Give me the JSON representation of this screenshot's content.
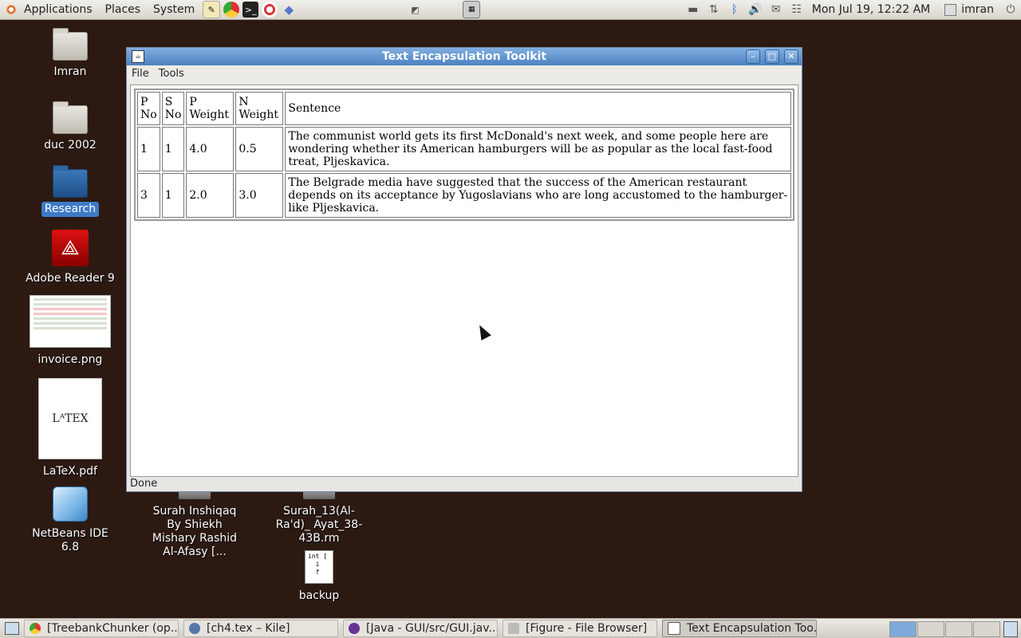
{
  "top_panel": {
    "menus": [
      "Applications",
      "Places",
      "System"
    ],
    "clock": "Mon Jul 19, 12:22 AM",
    "user": "imran"
  },
  "desktop_icons": [
    {
      "label": "Imran"
    },
    {
      "label": "duc 2002"
    },
    {
      "label": "Research"
    },
    {
      "label": "Adobe Reader 9"
    },
    {
      "label": "invoice.png"
    },
    {
      "label": "LaTeX.pdf"
    },
    {
      "label": "NetBeans IDE 6.8"
    },
    {
      "label": "Surah Inshiqaq By Shiekh Mishary Rashid Al-Afasy [..."
    },
    {
      "label": "Surah_13(Al-Ra'd)_ Ayat_38-43B.rm"
    },
    {
      "label": "backup"
    }
  ],
  "window": {
    "title": "Text Encapsulation Toolkit",
    "menu": [
      "File",
      "Tools"
    ],
    "status": "Done",
    "table": {
      "headers": [
        [
          "P",
          "No"
        ],
        [
          "S",
          "No"
        ],
        [
          "P",
          "Weight"
        ],
        [
          "N",
          "Weight"
        ],
        [
          "Sentence",
          ""
        ]
      ],
      "rows": [
        {
          "p_no": "1",
          "s_no": "1",
          "p_weight": "4.0",
          "n_weight": "0.5",
          "sentence": "The communist world gets its first McDonald's next week, and some people here are wondering whether its American hamburgers will be as popular as the local fast-food treat, Pljeskavica."
        },
        {
          "p_no": "3",
          "s_no": "1",
          "p_weight": "2.0",
          "n_weight": "3.0",
          "sentence": "The Belgrade media have suggested that the success of the American restaurant depends on its acceptance by Yugoslavians who are long accustomed to the hamburger-like Pljeskavica."
        }
      ]
    }
  },
  "taskbar": [
    {
      "label": "[TreebankChunker (op..."
    },
    {
      "label": "[ch4.tex – Kile]"
    },
    {
      "label": "[Java - GUI/src/GUI.jav..."
    },
    {
      "label": "[Figure - File Browser]"
    },
    {
      "label": "Text Encapsulation Too..."
    }
  ],
  "textfile_glyphs": "int [\n  i\n  f"
}
